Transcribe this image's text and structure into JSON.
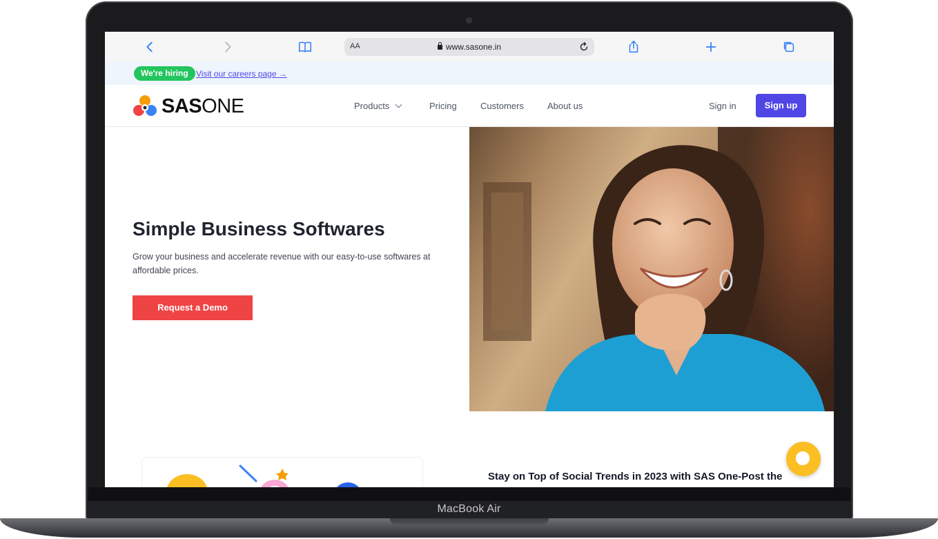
{
  "device": {
    "label": "MacBook Air"
  },
  "browser": {
    "address": {
      "text_size": "AA",
      "url": "www.sasone.in"
    }
  },
  "banner": {
    "badge": "We're hiring",
    "link": "Visit our careers page →"
  },
  "nav": {
    "logo_bold": "SAS",
    "logo_light": "ONE",
    "items": [
      "Products",
      "Pricing",
      "Customers",
      "About us"
    ],
    "sign_in": "Sign in",
    "sign_up": "Sign up"
  },
  "hero": {
    "title": "Simple Business Softwares",
    "subtitle": "Grow your business and accelerate revenue with our easy-to-use softwares at affordable prices.",
    "cta": "Request a Demo"
  },
  "blog": {
    "title": "Stay on Top of Social Trends in 2023 with SAS One-Post the"
  },
  "colors": {
    "primary": "#4f46e5",
    "cta": "#ef4444",
    "hiring": "#22c55e",
    "chat": "#fbbf24",
    "safari_blue": "#2f7cf6"
  }
}
